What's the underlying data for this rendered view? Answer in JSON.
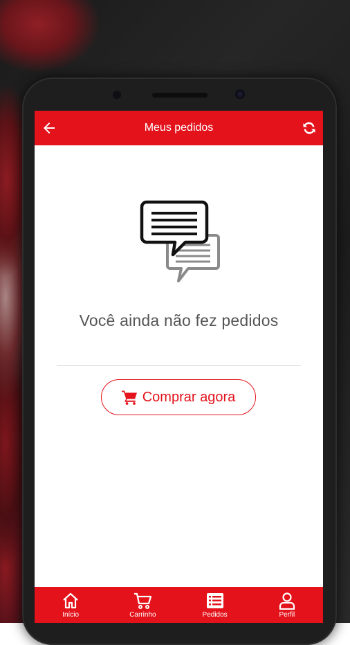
{
  "header": {
    "title": "Meus pedidos",
    "back_icon": "arrow-left-icon",
    "refresh_icon": "refresh-icon"
  },
  "empty_state": {
    "icon": "chat-bubbles-icon",
    "message": "Você ainda não fez pedidos"
  },
  "cta": {
    "icon": "shopping-cart-icon",
    "label": "Comprar agora"
  },
  "bottom_nav": {
    "items": [
      {
        "label": "Início",
        "icon": "home-icon"
      },
      {
        "label": "Carrinho",
        "icon": "cart-icon"
      },
      {
        "label": "Pedidos",
        "icon": "list-icon"
      },
      {
        "label": "Perfil",
        "icon": "user-icon"
      }
    ]
  },
  "colors": {
    "brand": "#e3121b",
    "text": "#555555"
  }
}
